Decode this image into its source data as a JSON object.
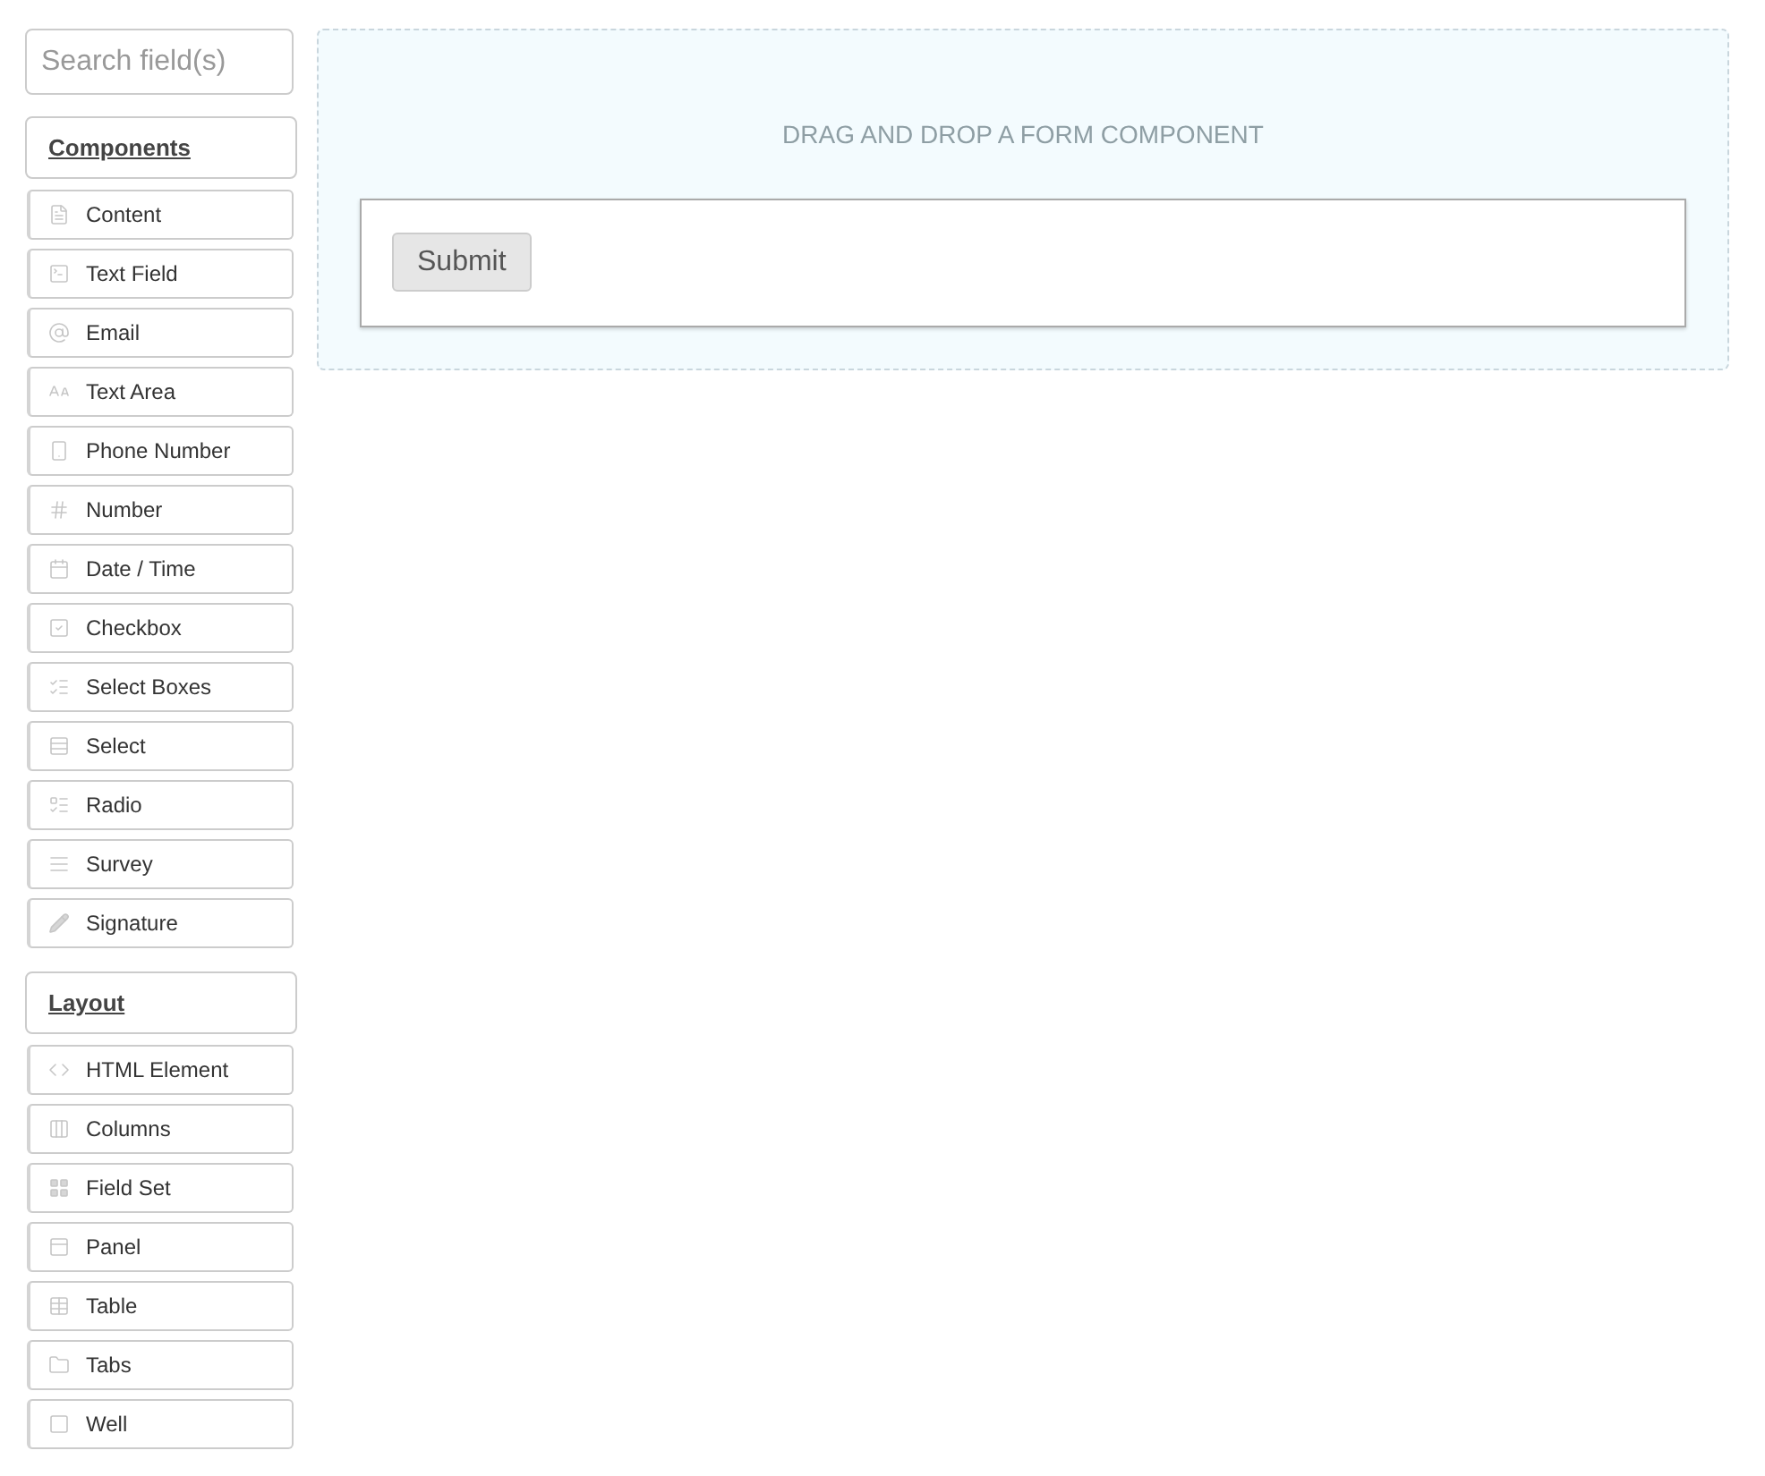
{
  "search": {
    "placeholder": "Search field(s)"
  },
  "groups": [
    {
      "title": "Components",
      "items": [
        "Content",
        "Text Field",
        "Email",
        "Text Area",
        "Phone Number",
        "Number",
        "Date / Time",
        "Checkbox",
        "Select Boxes",
        "Select",
        "Radio",
        "Survey",
        "Signature"
      ]
    },
    {
      "title": "Layout",
      "items": [
        "HTML Element",
        "Columns",
        "Field Set",
        "Panel",
        "Table",
        "Tabs",
        "Well"
      ]
    }
  ],
  "canvas": {
    "hint": "DRAG AND DROP A FORM COMPONENT",
    "buttons": [
      "Submit"
    ]
  }
}
